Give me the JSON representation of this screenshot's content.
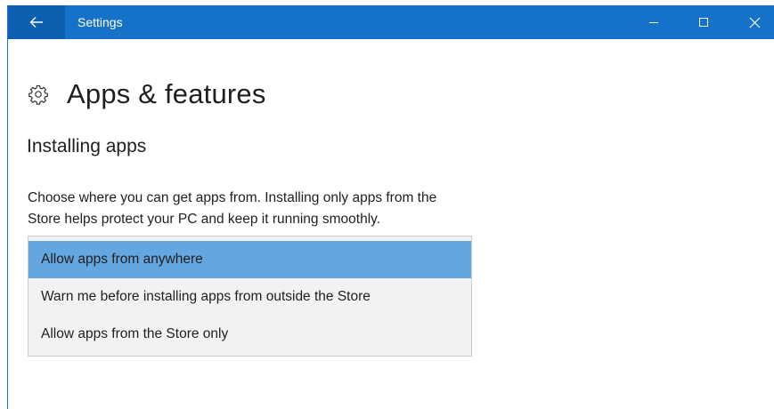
{
  "window": {
    "title": "Settings",
    "accent_color": "#1672c8",
    "back_icon": "back-arrow-icon",
    "controls": {
      "minimize_icon": "minimize-icon",
      "maximize_icon": "maximize-icon",
      "close_icon": "close-icon"
    }
  },
  "page": {
    "icon": "gear-icon",
    "title": "Apps & features"
  },
  "installing_apps": {
    "heading": "Installing apps",
    "description_line1": "Choose where you can get apps from. Installing only apps from the",
    "description_line2": "Store helps protect your PC and keep it running smoothly.",
    "selected_color": "#64a6e0",
    "options": [
      {
        "label": "Allow apps from anywhere",
        "selected": true
      },
      {
        "label": "Warn me before installing apps from outside the Store",
        "selected": false
      },
      {
        "label": "Allow apps from the Store only",
        "selected": false
      }
    ]
  }
}
